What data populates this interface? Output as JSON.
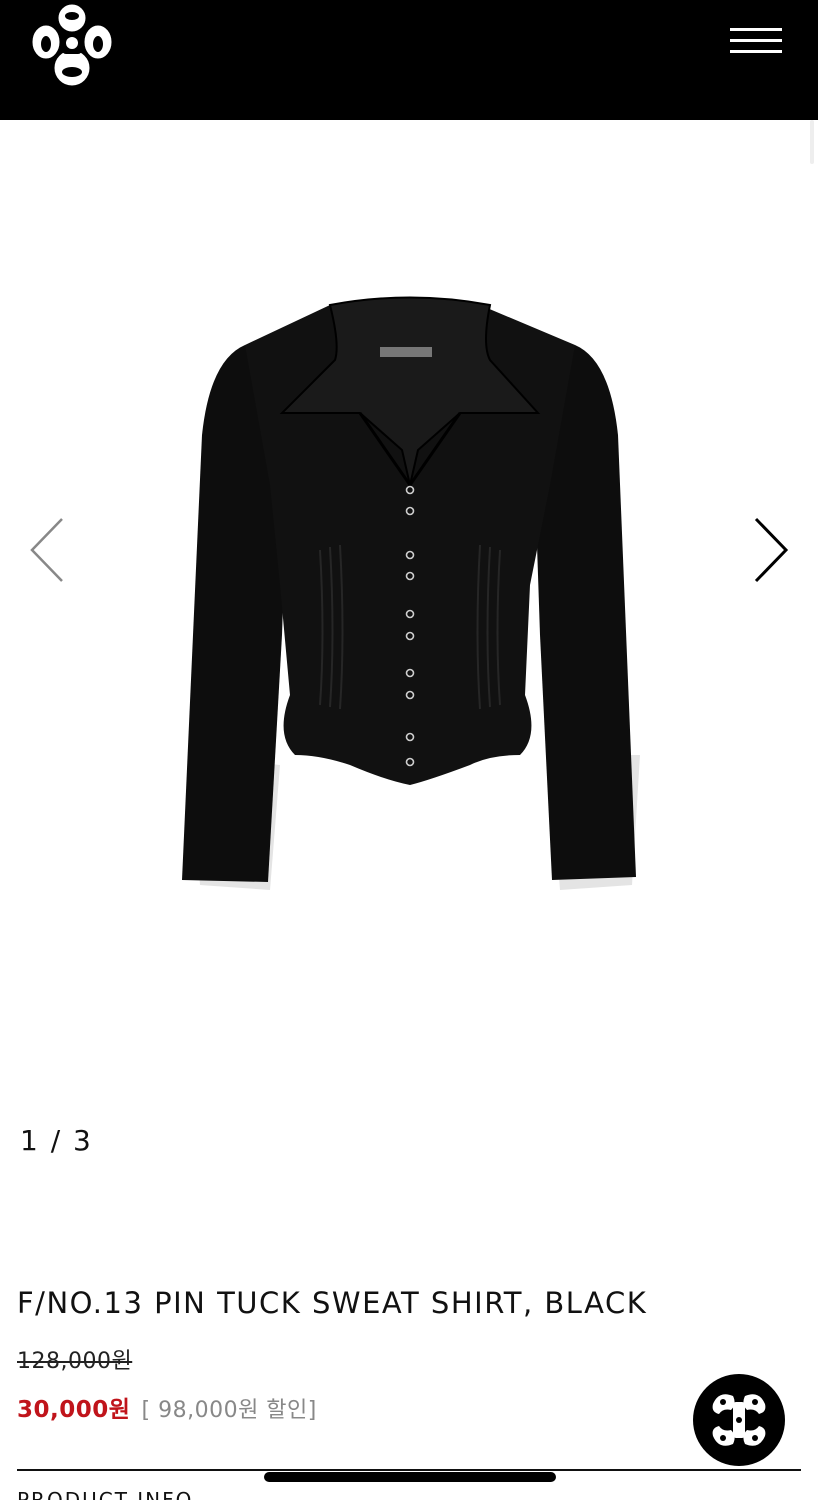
{
  "header": {
    "logo_icon": "brand-emblem-icon",
    "menu_icon": "hamburger-menu-icon"
  },
  "gallery": {
    "image_alt": "F/NO.13 PIN TUCK SWEAT SHIRT, BLACK",
    "prev_icon": "chevron-left-icon",
    "next_icon": "chevron-right-icon",
    "pager": "1 / 3"
  },
  "product": {
    "title": "F/NO.13 PIN TUCK SWEAT SHIRT, BLACK",
    "original_price": "128,000원",
    "sale_price": "30,000원",
    "discount_text": "[ 98,000원 할인]"
  },
  "section": {
    "label": "PRODUCT INFO",
    "toggle": "−"
  },
  "colors": {
    "header_bg": "#000000",
    "sale_price": "#c0141b",
    "discount_text": "#888888"
  },
  "chat": {
    "icon": "chat-emblem-icon"
  }
}
